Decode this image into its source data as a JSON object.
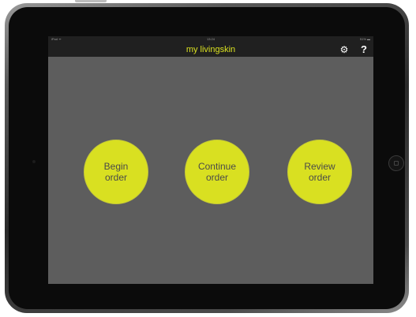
{
  "status_bar": {
    "carrier": "iPad ᯤ",
    "time": "13:24",
    "battery": "51% ▬"
  },
  "nav": {
    "title": "my livingskin",
    "settings_icon": "⚙",
    "help_label": "?"
  },
  "buttons": [
    {
      "line1": "Begin",
      "line2": "order"
    },
    {
      "line1": "Continue",
      "line2": "order"
    },
    {
      "line1": "Review",
      "line2": "order"
    }
  ],
  "colors": {
    "accent": "#d9e021",
    "background": "#5d5d5d",
    "nav_bar": "#202020"
  },
  "icons": [
    "gear-icon",
    "help-icon",
    "home-button"
  ]
}
